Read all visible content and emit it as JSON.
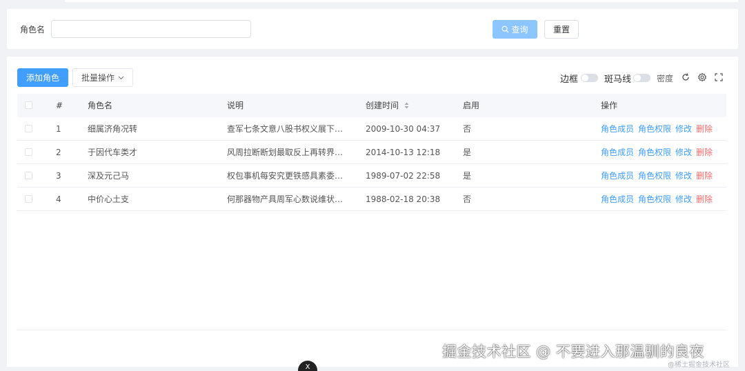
{
  "search": {
    "label": "角色名",
    "value": "",
    "placeholder": "",
    "query_label": "查询",
    "reset_label": "重置"
  },
  "toolbar": {
    "add_label": "添加角色",
    "batch_label": "批量操作",
    "border_label": "边框",
    "stripe_label": "斑马线",
    "density_label": "密度"
  },
  "table": {
    "columns": [
      "#",
      "角色名",
      "说明",
      "创建时间",
      "启用",
      "操作"
    ],
    "rows": [
      {
        "idx": "1",
        "name": "细属济角况转",
        "desc": "查军七条文意八股书权义展下。...",
        "time": "2009-10-30 04:37",
        "enabled": "否"
      },
      {
        "idx": "2",
        "name": "于因代车类才",
        "desc": "风周拉断断划最取反上再转界用...",
        "time": "2014-10-13 12:18",
        "enabled": "是"
      },
      {
        "idx": "3",
        "name": "深及元己马",
        "desc": "权包事机每安究更铁感具素委。...",
        "time": "1989-07-02 22:58",
        "enabled": "是"
      },
      {
        "idx": "4",
        "name": "中价心土支",
        "desc": "何那器物产具周军心数说维状。...",
        "time": "1988-02-18 20:38",
        "enabled": "否"
      }
    ],
    "actions": {
      "members": "角色成员",
      "perms": "角色权限",
      "edit": "修改",
      "delete": "删除"
    }
  },
  "watermark": "掘金技术社区 @ 不要进入那温驯的良夜",
  "corner_mark": "@稀土掘金技术社区",
  "badge": "X",
  "colors": {
    "primary": "#409eff",
    "primary_light": "#8cc5ff",
    "danger": "#f56c6c"
  },
  "icons": [
    "search-icon",
    "chevron-down-icon",
    "sort-icon",
    "refresh-icon",
    "gear-icon",
    "fullscreen-icon"
  ]
}
